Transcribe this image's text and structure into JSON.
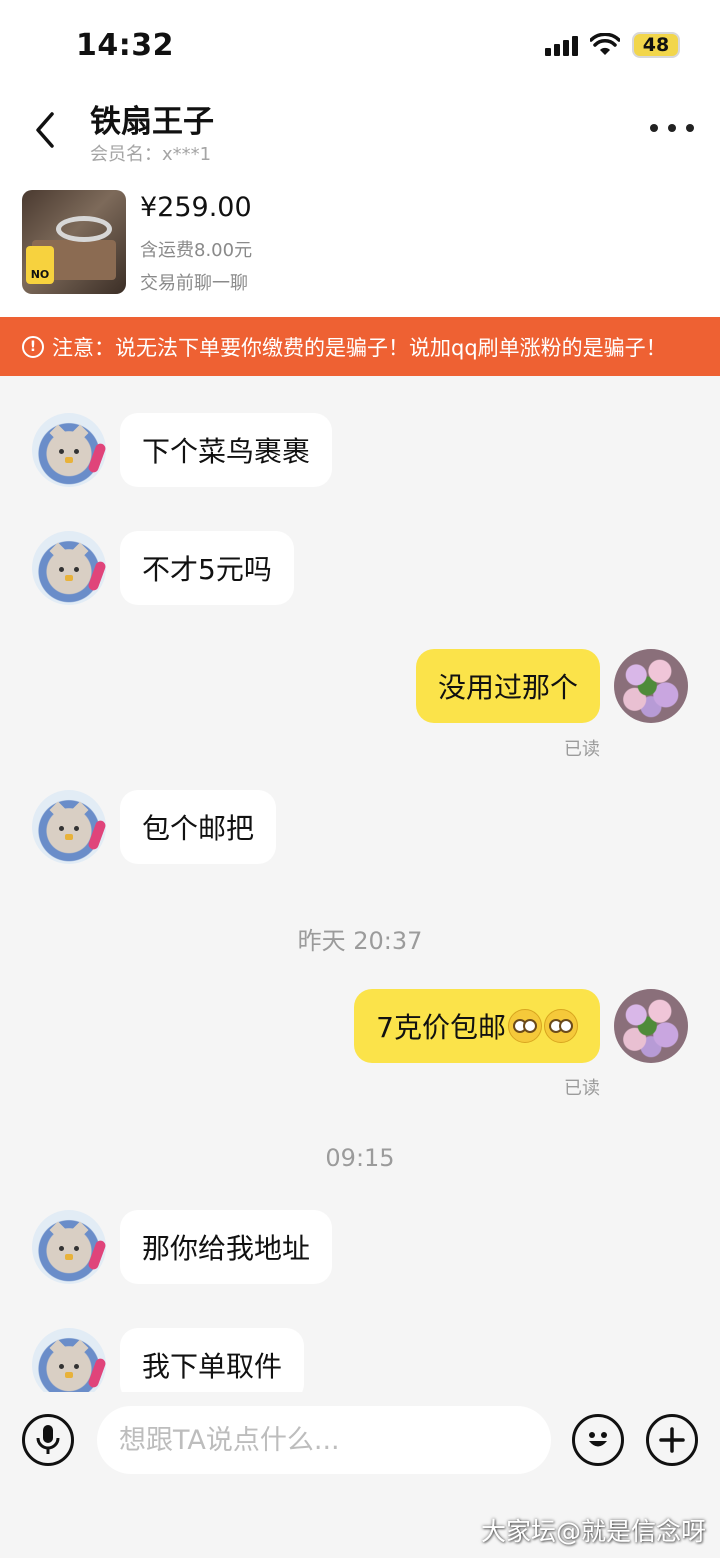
{
  "status_bar": {
    "time": "14:32",
    "battery": "48"
  },
  "header": {
    "title": "铁扇王子",
    "member": "会员名：x***1"
  },
  "product": {
    "price": "¥259.00",
    "shipping": "含运费8.00元",
    "note": "交易前聊一聊",
    "badge": "NO"
  },
  "warning": {
    "icon": "!",
    "text": "注意：说无法下单要你缴费的是骗子！说加qq刷单涨粉的是骗子！"
  },
  "messages": [
    {
      "side": "in",
      "text": "下个菜鸟裹裹"
    },
    {
      "side": "in",
      "text": "不才5元吗"
    },
    {
      "side": "out",
      "text": "没用过那个",
      "status": "已读"
    },
    {
      "side": "in",
      "text": "包个邮把"
    },
    {
      "side": "out",
      "text": "7克价包邮",
      "status": "已读",
      "emoji": [
        "flushed-emoji",
        "flushed-emoji"
      ]
    },
    {
      "side": "in",
      "text": "那你给我地址"
    },
    {
      "side": "in",
      "text": "我下单取件"
    }
  ],
  "timestamps": [
    "昨天 20:37",
    "09:15"
  ],
  "input": {
    "placeholder": "想跟TA说点什么..."
  },
  "watermark": "大家坛@就是信念呀",
  "colors": {
    "warning_bg": "#ee6133",
    "outgoing_bubble": "#fbe34a",
    "incoming_bubble": "#ffffff",
    "background": "#f5f5f5"
  },
  "icons": [
    "back-icon",
    "more-icon",
    "mic-icon",
    "emoji-icon",
    "plus-icon",
    "wifi-icon",
    "signal-icon"
  ]
}
